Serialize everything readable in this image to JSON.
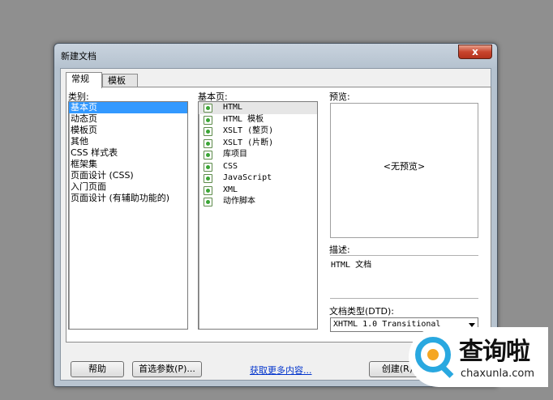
{
  "window": {
    "title": "新建文档",
    "close_label": "x"
  },
  "tabs": [
    {
      "label": "常规"
    },
    {
      "label": "模板"
    }
  ],
  "category": {
    "label": "类别:",
    "items": [
      "基本页",
      "动态页",
      "模板页",
      "其他",
      "CSS 样式表",
      "框架集",
      "页面设计 (CSS)",
      "入门页面",
      "页面设计 (有辅助功能的)"
    ],
    "selected": "基本页"
  },
  "basic_page": {
    "label": "基本页:",
    "items": [
      "HTML",
      "HTML 模板",
      "XSLT (整页)",
      "XSLT (片断)",
      "库项目",
      "CSS",
      "JavaScript",
      "XML",
      "动作脚本"
    ],
    "selected": "HTML"
  },
  "preview": {
    "label": "预览:",
    "text": "<无预览>"
  },
  "description": {
    "label": "描述:",
    "text": "HTML 文档"
  },
  "doctype": {
    "label": "文档类型(DTD):",
    "value": "XHTML 1.0 Transitional"
  },
  "buttons": {
    "help": "帮助",
    "preferences": "首选参数(P)...",
    "more_content": "获取更多内容...",
    "create": "创建(R)"
  },
  "watermark": {
    "title": "查询啦",
    "sub": "chaxunla.com"
  },
  "colors": {
    "selection": "#3399ff",
    "link": "#0033cc",
    "watermark_blue": "#29a8e0"
  }
}
